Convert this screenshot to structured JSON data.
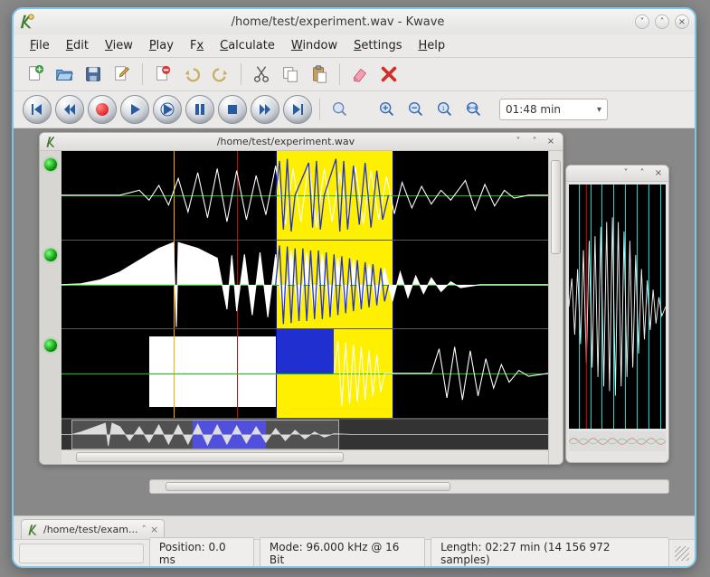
{
  "window": {
    "title": "/home/test/experiment.wav - Kwave"
  },
  "menu": {
    "file": "File",
    "edit": "Edit",
    "view": "View",
    "play": "Play",
    "fx": "Fx",
    "calculate": "Calculate",
    "window": "Window",
    "settings": "Settings",
    "help": "Help"
  },
  "toolbar": {
    "time_display": "01:48 min"
  },
  "document": {
    "title": "/home/test/experiment.wav",
    "tracks": 3
  },
  "tab": {
    "label": "/home/test/exam..."
  },
  "status": {
    "position": "Position: 0.0 ms",
    "mode": "Mode: 96.000 kHz @ 16 Bit",
    "length": "Length: 02:27 min (14 156 972 samples)"
  }
}
